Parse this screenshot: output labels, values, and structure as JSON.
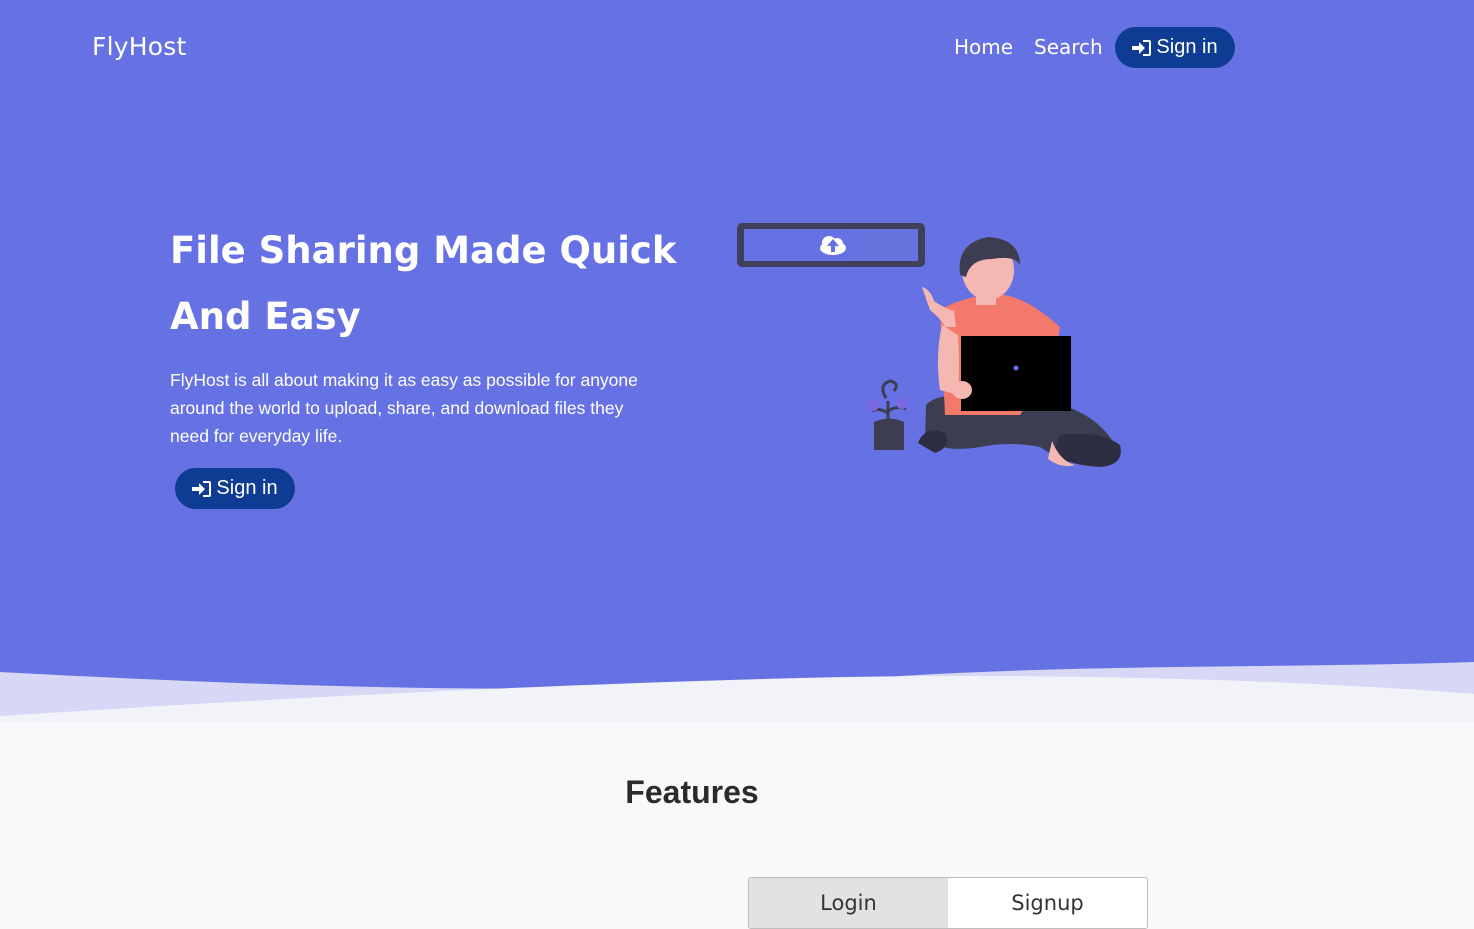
{
  "header": {
    "brand": "FlyHost",
    "nav": {
      "home": "Home",
      "search": "Search",
      "signin": "Sign in"
    }
  },
  "hero": {
    "title": "File Sharing Made Quick And Easy",
    "description": "FlyHost is all about making it as easy as possible for anyone around the world to upload, share, and download files they need for everyday life.",
    "cta": "Sign in"
  },
  "features": {
    "title": "Features",
    "tabs": [
      {
        "label": "Login",
        "active": true
      },
      {
        "label": "Signup",
        "active": false
      }
    ]
  },
  "colors": {
    "hero_bg": "#6672e3",
    "button_bg": "#0f3c93",
    "page_bg": "#f9f9fb"
  },
  "icons": {
    "signin": "sign-in-icon",
    "upload": "cloud-upload-icon"
  }
}
